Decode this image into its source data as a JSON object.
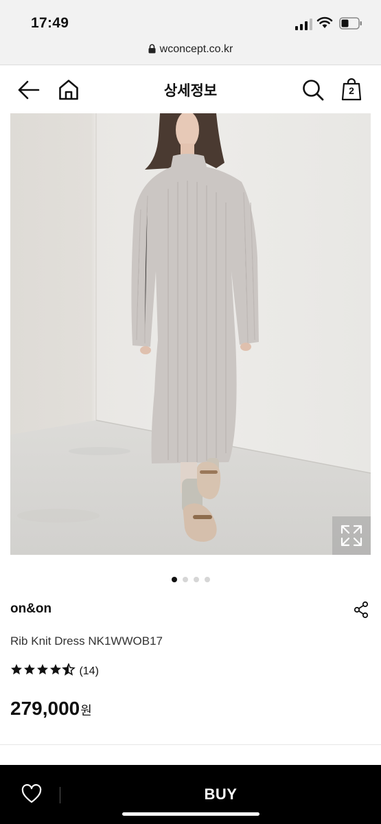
{
  "status_bar": {
    "time": "17:49"
  },
  "browser": {
    "url": "wconcept.co.kr"
  },
  "nav": {
    "title": "상세정보",
    "cart_count": "2"
  },
  "icons": [
    "lock-icon",
    "back-arrow-icon",
    "home-icon",
    "search-icon",
    "bag-icon",
    "expand-icon",
    "share-icon",
    "star-icon",
    "heart-icon"
  ],
  "gallery": {
    "total_images": 4,
    "active_index": 0
  },
  "product": {
    "brand": "on&on",
    "name": "Rib Knit Dress NK1WWOB17",
    "rating": 4.5,
    "review_count": "(14)",
    "price": "279,000",
    "currency": "원"
  },
  "actions": {
    "buy_label": "BUY"
  },
  "colors": {
    "accent": "#000000",
    "background": "#ffffff",
    "chrome": "#f2f2f2"
  }
}
